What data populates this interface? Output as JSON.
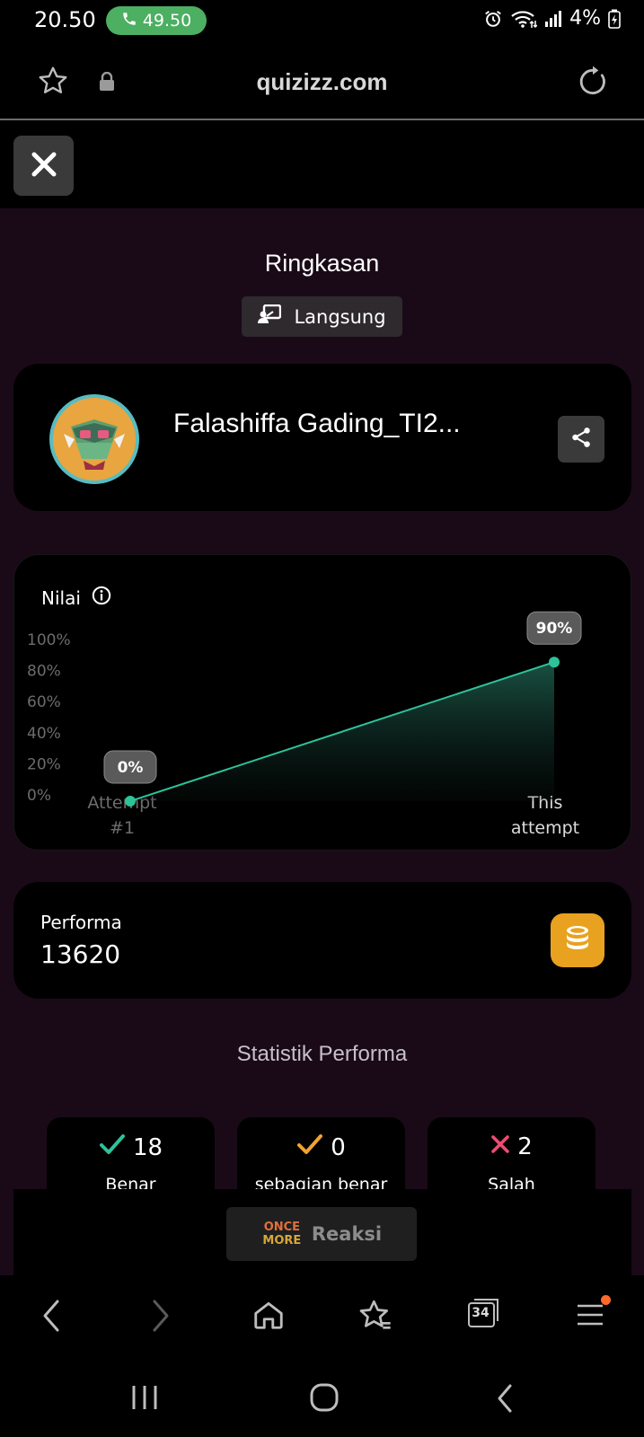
{
  "status_bar": {
    "time": "20.50",
    "call_duration": "49.50",
    "battery": "4%"
  },
  "browser": {
    "url": "quizizz.com",
    "tab_count": "34"
  },
  "summary": {
    "title": "Ringkasan",
    "mode": "Langsung"
  },
  "player": {
    "name": "Falashiffa Gading_TI2..."
  },
  "score_chart": {
    "heading": "Nilai"
  },
  "chart_data": {
    "type": "area",
    "title": "Nilai",
    "categories": [
      "Attempt #1",
      "This attempt"
    ],
    "values": [
      0,
      90
    ],
    "value_labels": [
      "0%",
      "90%"
    ],
    "y_ticks": [
      "100%",
      "80%",
      "60%",
      "40%",
      "20%",
      "0%"
    ],
    "ylim": [
      0,
      100
    ],
    "grid": false,
    "colors": {
      "line": "#2ec29a",
      "fill": "#1c5a49"
    }
  },
  "performance": {
    "label": "Performa",
    "value": "13620"
  },
  "stats": {
    "heading": "Statistik Performa",
    "items": [
      {
        "value": "18",
        "label": "Benar",
        "icon": "check-icon",
        "color": "#2ec29a"
      },
      {
        "value": "0",
        "label": "sebagian benar",
        "icon": "check-icon",
        "color": "#efa32f"
      },
      {
        "value": "2",
        "label": "Salah",
        "icon": "cross-icon",
        "color": "#ec4d72"
      }
    ]
  },
  "reaction": {
    "sticker_line1": "ONCE",
    "sticker_line2": "MORE",
    "label": "Reaksi"
  },
  "colors": {
    "background": "#1a0a18",
    "card": "#000000",
    "call_pill": "#4caf62",
    "coin": "#e8a21f",
    "notification_dot": "#ff6a2a"
  }
}
